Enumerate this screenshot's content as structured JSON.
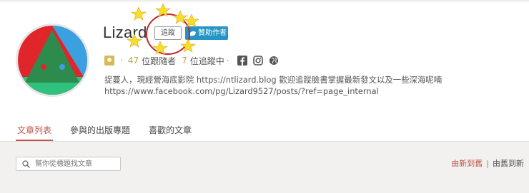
{
  "profile": {
    "name": "Lizard",
    "follow_label": "追蹤",
    "sponsor_label": "贊助作者",
    "followers_count": "47",
    "followers_label": "位跟隨者",
    "following_count": "7",
    "following_label": "位追蹤中",
    "bio_line1": "捉蔓人，現經營海底影院 https://ntlizard.blog 歡迎追蹤臉書掌握最新發文以及一些深海呢喃",
    "bio_line2": "https://www.facebook.com/pg/Lizard9527/posts/?ref=page_internal"
  },
  "tabs": [
    {
      "label": "文章列表",
      "active": true
    },
    {
      "label": "參與的出版專題",
      "active": false
    },
    {
      "label": "喜歡的文章",
      "active": false
    }
  ],
  "search": {
    "placeholder": "幫你從標題找文章"
  },
  "sort": {
    "newest": "由新到舊",
    "oldest": "由舊到新"
  },
  "colors": {
    "accent": "#c0564e",
    "sponsor": "#2596c4",
    "gold": "#c9a24a"
  },
  "icons": [
    "facebook-icon",
    "instagram-icon",
    "globe-icon",
    "search-icon",
    "coin-icon"
  ]
}
